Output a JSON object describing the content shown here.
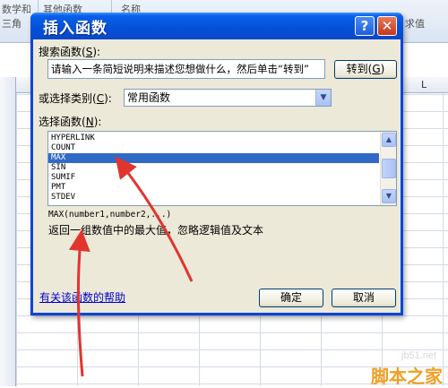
{
  "background": {
    "ribbon_items": [
      "数学和",
      "其他函数",
      "名称",
      "三角",
      "求值"
    ],
    "column_letter": "L"
  },
  "dialog": {
    "title": "插入函数",
    "help_glyph": "?",
    "close_glyph": "✕",
    "search_label": "搜索函数",
    "search_hotkey": "S",
    "search_value": "请输入一条简短说明来描述您想做什么，然后单击“转到”",
    "go_button": "转到",
    "go_hotkey": "G",
    "category_label": "或选择类别",
    "category_hotkey": "C",
    "category_value": "常用函数",
    "list_label": "选择函数",
    "list_hotkey": "N",
    "functions": [
      "HYPERLINK",
      "COUNT",
      "MAX",
      "SIN",
      "SUMIF",
      "PMT",
      "STDEV"
    ],
    "selected_function": "MAX",
    "signature": "MAX(number1,number2,...)",
    "description": "返回一组数值中的最大值，忽略逻辑值及文本",
    "help_link": "有关该函数的帮助",
    "ok_button": "确定",
    "cancel_button": "取消"
  },
  "watermark": {
    "site": "jb51.net",
    "brand": "脚本之家"
  },
  "colors": {
    "title_bar": "#0450d8",
    "dialog_bg": "#ece9d8",
    "selection": "#316ac5",
    "annotation_arrow": "#e2342f"
  }
}
